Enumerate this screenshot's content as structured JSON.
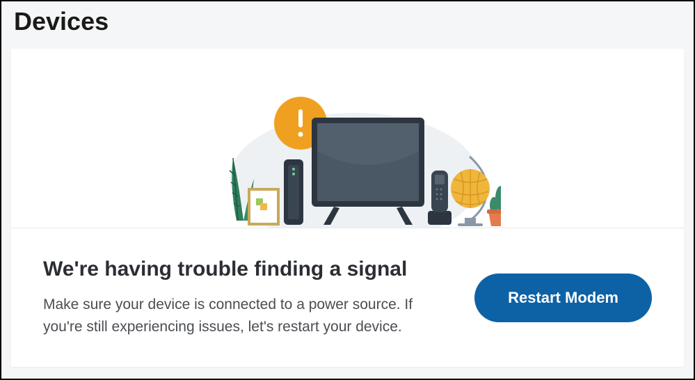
{
  "header": {
    "title": "Devices"
  },
  "message": {
    "heading": "We're having trouble finding a signal",
    "body": "Make sure your device is connected to a power source. If you're still experiencing issues, let's restart your device.",
    "button_label": "Restart Modem"
  },
  "colors": {
    "accent": "#0d62a6",
    "alert": "#f0a020"
  }
}
